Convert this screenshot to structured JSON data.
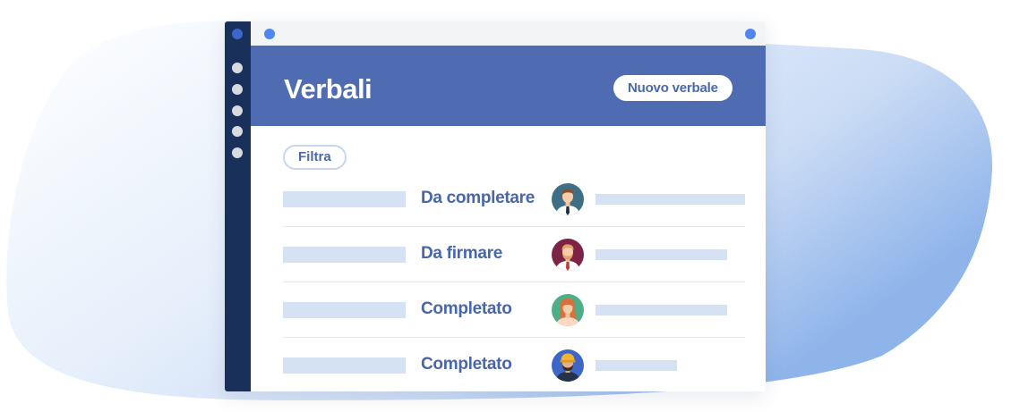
{
  "header": {
    "title": "Verbali",
    "new_button_label": "Nuovo verbale"
  },
  "filter": {
    "label": "Filtra"
  },
  "rows": [
    {
      "status": "Da completare",
      "avatar": "man-with-tie-avatar"
    },
    {
      "status": "Da firmare",
      "avatar": "bearded-man-avatar"
    },
    {
      "status": "Completato",
      "avatar": "woman-avatar"
    },
    {
      "status": "Completato",
      "avatar": "worker-with-helmet-avatar"
    }
  ],
  "colors": {
    "header": "#4f6cb2",
    "rail": "#18305a",
    "accent_text": "#4766ab",
    "placeholder": "#d4e2f4",
    "titlebar_dot": "#4f86f0"
  }
}
